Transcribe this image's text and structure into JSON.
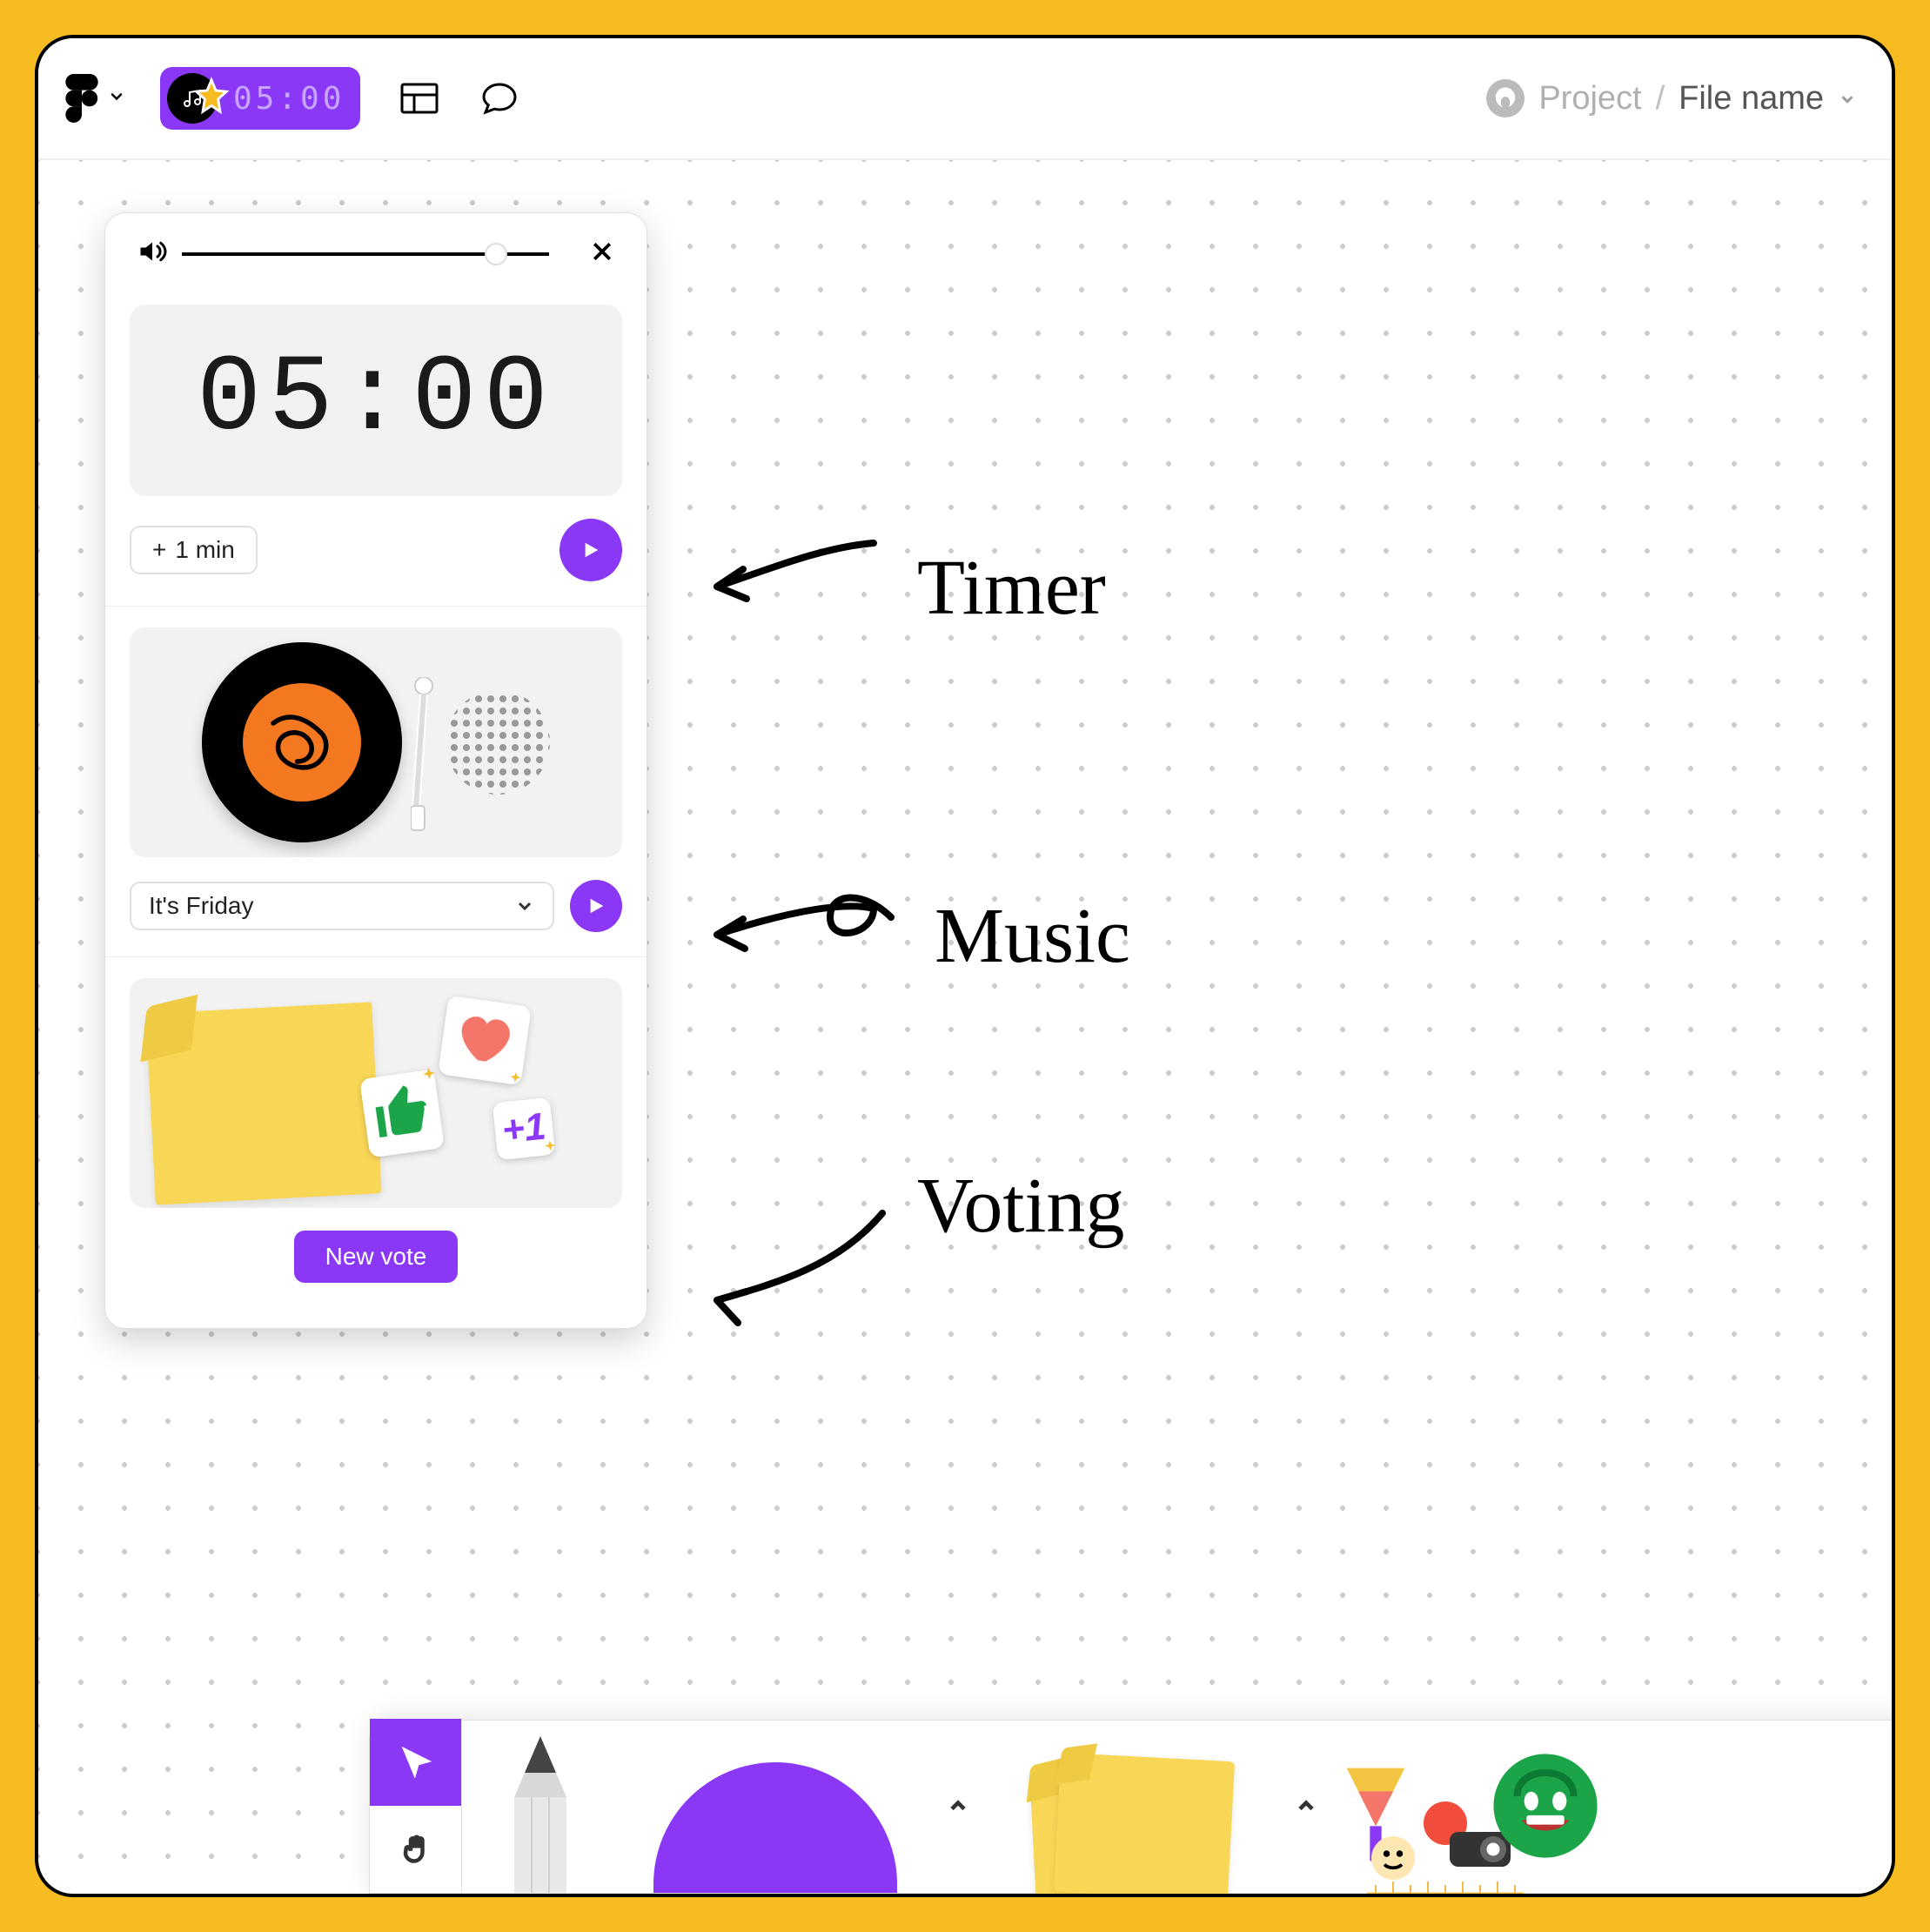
{
  "colors": {
    "accent": "#8A38F5",
    "frame": "#F6BC22"
  },
  "topbar": {
    "timer_pill": "05:00",
    "breadcrumb": {
      "project": "Project",
      "file": "File name"
    }
  },
  "panel": {
    "timer": {
      "display": "05:00",
      "add_label": "1 min",
      "add_prefix": "+"
    },
    "music": {
      "selected": "It's Friday"
    },
    "voting": {
      "button": "New vote",
      "plus1": "+1"
    }
  },
  "annotations": {
    "timer": "Timer",
    "music": "Music",
    "voting": "Voting"
  }
}
